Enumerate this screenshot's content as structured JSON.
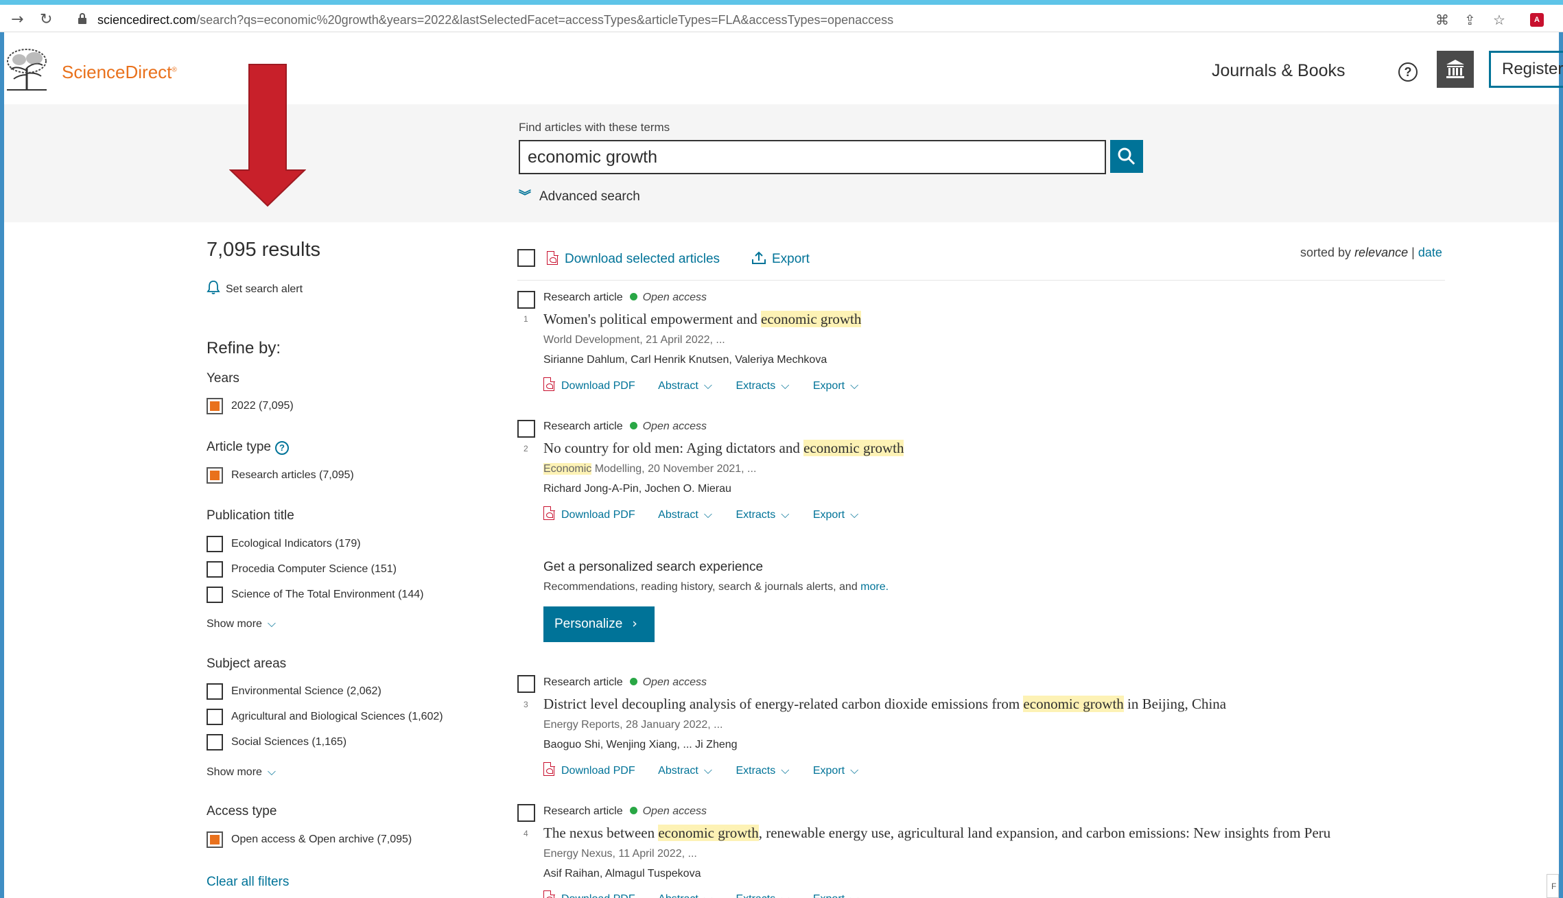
{
  "browser": {
    "url_host": "sciencedirect.com",
    "url_rest": "/search?qs=economic%20growth&years=2022&lastSelectedFacet=accessTypes&articleTypes=FLA&accessTypes=openaccess"
  },
  "header": {
    "brand": "ScienceDirect",
    "journals_books": "Journals & Books",
    "register": "Register"
  },
  "search": {
    "label": "Find articles with these terms",
    "query": "economic growth",
    "advanced": "Advanced search"
  },
  "sidebar": {
    "results_count": "7,095 results",
    "search_alert": "Set search alert",
    "refine_title": "Refine by:",
    "years": {
      "title": "Years",
      "items": [
        {
          "label": "2022 (7,095)",
          "checked": true
        }
      ]
    },
    "article_type": {
      "title": "Article type",
      "items": [
        {
          "label": "Research articles (7,095)",
          "checked": true
        }
      ]
    },
    "publication_title": {
      "title": "Publication title",
      "items": [
        {
          "label": "Ecological Indicators (179)",
          "checked": false
        },
        {
          "label": "Procedia Computer Science (151)",
          "checked": false
        },
        {
          "label": "Science of The Total Environment (144)",
          "checked": false
        }
      ],
      "show_more": "Show more"
    },
    "subject_areas": {
      "title": "Subject areas",
      "items": [
        {
          "label": "Environmental Science (2,062)",
          "checked": false
        },
        {
          "label": "Agricultural and Biological Sciences (1,602)",
          "checked": false
        },
        {
          "label": "Social Sciences (1,165)",
          "checked": false
        }
      ],
      "show_more": "Show more"
    },
    "access_type": {
      "title": "Access type",
      "items": [
        {
          "label": "Open access & Open archive (7,095)",
          "checked": true
        }
      ]
    },
    "clear_all": "Clear all filters"
  },
  "toolbar": {
    "download_selected": "Download selected articles",
    "export": "Export",
    "sorted_by": "sorted by",
    "relevance": "relevance",
    "separator": "|",
    "date": "date"
  },
  "results": [
    {
      "number": "1",
      "type": "Research article",
      "access": "Open access",
      "title_parts": [
        "Women's political empowerment and ",
        "economic growth",
        ""
      ],
      "source": "World Development, 21 April 2022, ...",
      "authors": "Sirianne Dahlum, Carl Henrik Knutsen, Valeriya Mechkova"
    },
    {
      "number": "2",
      "type": "Research article",
      "access": "Open access",
      "title_parts": [
        "No country for old men: Aging dictators and ",
        "economic growth",
        ""
      ],
      "source_highlight": "Economic",
      "source": " Modelling, 20 November 2021, ...",
      "authors": "Richard Jong-A-Pin, Jochen O. Mierau"
    },
    {
      "number": "3",
      "type": "Research article",
      "access": "Open access",
      "title_parts": [
        "District level decoupling analysis of energy-related carbon dioxide emissions from ",
        "economic growth",
        " in Beijing, China"
      ],
      "source": "Energy Reports, 28 January 2022, ...",
      "authors": "Baoguo Shi, Wenjing Xiang, ... Ji Zheng"
    },
    {
      "number": "4",
      "type": "Research article",
      "access": "Open access",
      "title_parts": [
        "The nexus between ",
        "economic growth",
        ", renewable energy use, agricultural land expansion, and carbon emissions: New insights from Peru"
      ],
      "source": "Energy Nexus, 11 April 2022, ...",
      "authors": "Asif Raihan, Almagul Tuspekova"
    }
  ],
  "actions": {
    "download_pdf": "Download PDF",
    "abstract": "Abstract",
    "extracts": "Extracts",
    "export": "Export"
  },
  "promo": {
    "title": "Get a personalized search experience",
    "text": "Recommendations, reading history, search & journals alerts, and ",
    "more": "more.",
    "button": "Personalize"
  },
  "colors": {
    "brand_orange": "#e9711c",
    "link_blue": "#007398",
    "highlight": "#fdf2b5",
    "open_access_green": "#29a745",
    "arrow_red": "#c8202a"
  }
}
